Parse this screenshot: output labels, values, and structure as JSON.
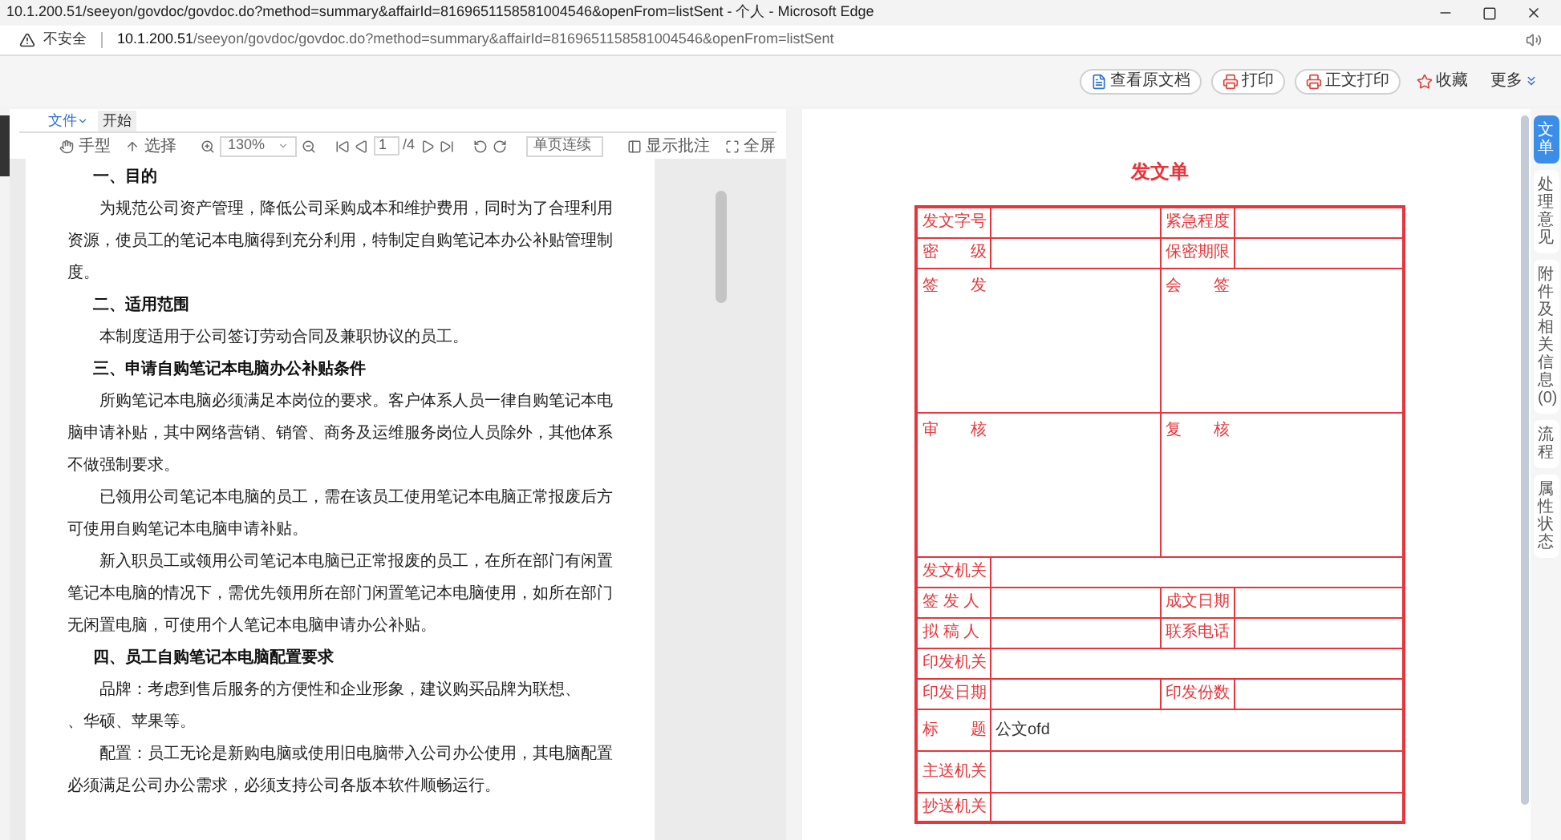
{
  "browser": {
    "title": "10.1.200.51/seeyon/govdoc/govdoc.do?method=summary&affairId=8169651158581004546&openFrom=listSent - 个人 - Microsoft Edge",
    "security_label": "不安全",
    "url_host": "10.1.200.51",
    "url_path": "/seeyon/govdoc/govdoc.do?method=summary&affairId=8169651158581004546&openFrom=listSent"
  },
  "actions": [
    {
      "kind": "doc",
      "label": "查看原文档"
    },
    {
      "kind": "print",
      "label": "打印"
    },
    {
      "kind": "print",
      "label": "正文打印"
    },
    {
      "kind": "star",
      "label": "收藏"
    },
    {
      "kind": "more",
      "label": "更多"
    }
  ],
  "viewer": {
    "file_menu": "文件",
    "tabs": [
      {
        "label": "开始",
        "selected": true
      }
    ],
    "toolbar": [
      {
        "kind": "hand",
        "label": "手型"
      },
      {
        "kind": "select",
        "label": "选择"
      },
      {
        "kind": "separator"
      },
      {
        "kind": "zoomin"
      },
      {
        "kind": "dropdown",
        "label": "130%"
      },
      {
        "kind": "zoomout"
      },
      {
        "kind": "separator"
      },
      {
        "kind": "first"
      },
      {
        "kind": "prev"
      },
      {
        "kind": "page",
        "label": "1",
        "total": "/4"
      },
      {
        "kind": "next"
      },
      {
        "kind": "last"
      },
      {
        "kind": "separator"
      },
      {
        "kind": "rotateleft"
      },
      {
        "kind": "rotateright"
      },
      {
        "kind": "separator"
      },
      {
        "kind": "dropdown",
        "label": "单页连续"
      },
      {
        "kind": "separator"
      },
      {
        "kind": "annotations",
        "label": "显示批注"
      },
      {
        "kind": "fullscreen",
        "label": "全屏"
      }
    ],
    "document": [
      {
        "kind": "heading",
        "text": "一、目的"
      },
      {
        "kind": "paragraph",
        "text": "为规范公司资产管理，降低公司采购成本和维护费用，同时为了合理利用资源，使员工的笔记本电脑得到充分利用，特制定自购笔记本办公补贴管理制度。"
      },
      {
        "kind": "heading",
        "text": "二、适用范围"
      },
      {
        "kind": "paragraph",
        "text": "本制度适用于公司签订劳动合同及兼职协议的员工。"
      },
      {
        "kind": "heading",
        "text": "三、申请自购笔记本电脑办公补贴条件"
      },
      {
        "kind": "paragraph",
        "text": "所购笔记本电脑必须满足本岗位的要求。客户体系人员一律自购笔记本电脑申请补贴，其中网络营销、销管、商务及运维服务岗位人员除外，其他体系不做强制要求。"
      },
      {
        "kind": "paragraph",
        "text": "已领用公司笔记本电脑的员工，需在该员工使用笔记本电脑正常报废后方可使用自购笔记本电脑申请补贴。"
      },
      {
        "kind": "paragraph",
        "text": "新入职员工或领用公司笔记本电脑已正常报废的员工，在所在部门有闲置笔记本电脑的情况下，需优先领用所在部门闲置笔记本电脑使用，如所在部门无闲置电脑，可使用个人笔记本电脑申请办公补贴。"
      },
      {
        "kind": "heading",
        "text": "四、员工自购笔记本电脑配置要求"
      },
      {
        "kind": "paragraph",
        "text": "品牌：考虑到售后服务的方便性和企业形象，建议购买品牌为联想、"
      },
      {
        "kind": "continuation",
        "text": "、华硕、苹果等。"
      },
      {
        "kind": "paragraph",
        "text": "配置：员工无论是新购电脑或使用旧电脑带入公司办公使用，其电脑配置必须满足公司办公需求，必须支持公司各版本软件顺畅运行。"
      }
    ]
  },
  "form": {
    "title": "发文单",
    "rows": [
      {
        "kind": "normal",
        "cells": [
          {
            "kind": "label",
            "text": "发文字号"
          },
          {
            "kind": "value"
          },
          {
            "kind": "label",
            "text": "紧急程度"
          },
          {
            "kind": "value"
          }
        ]
      },
      {
        "kind": "normal",
        "cells": [
          {
            "kind": "label",
            "text": "密　　级"
          },
          {
            "kind": "value"
          },
          {
            "kind": "label",
            "text": "保密期限"
          },
          {
            "kind": "value"
          }
        ]
      },
      {
        "kind": "tall",
        "cells": [
          {
            "kind": "box",
            "text": "签　　发",
            "colspan": 2
          },
          {
            "kind": "box",
            "text": "会　　签",
            "colspan": 2
          }
        ]
      },
      {
        "kind": "tall",
        "cells": [
          {
            "kind": "box",
            "text": "审　　核",
            "colspan": 2
          },
          {
            "kind": "box",
            "text": "复　　核",
            "colspan": 2
          }
        ]
      },
      {
        "kind": "normal",
        "cells": [
          {
            "kind": "label",
            "text": "发文机关"
          },
          {
            "kind": "value",
            "colspan": 3
          }
        ]
      },
      {
        "kind": "normal",
        "cells": [
          {
            "kind": "label",
            "text": "签 发 人"
          },
          {
            "kind": "value"
          },
          {
            "kind": "label",
            "text": "成文日期"
          },
          {
            "kind": "value"
          }
        ]
      },
      {
        "kind": "normal",
        "cells": [
          {
            "kind": "label",
            "text": "拟 稿 人"
          },
          {
            "kind": "value"
          },
          {
            "kind": "label",
            "text": "联系电话"
          },
          {
            "kind": "value"
          }
        ]
      },
      {
        "kind": "normal",
        "cells": [
          {
            "kind": "label",
            "text": "印发机关"
          },
          {
            "kind": "value",
            "colspan": 3
          }
        ]
      },
      {
        "kind": "normal",
        "cells": [
          {
            "kind": "label",
            "text": "印发日期"
          },
          {
            "kind": "value"
          },
          {
            "kind": "label",
            "text": "印发份数"
          },
          {
            "kind": "value"
          }
        ]
      },
      {
        "kind": "medium",
        "cells": [
          {
            "kind": "label",
            "text": "标　　题"
          },
          {
            "kind": "value",
            "text": "公文ofd",
            "colspan": 3
          }
        ]
      },
      {
        "kind": "medium",
        "cells": [
          {
            "kind": "label",
            "text": "主送机关"
          },
          {
            "kind": "value",
            "colspan": 3
          }
        ]
      },
      {
        "kind": "normal",
        "cells": [
          {
            "kind": "label",
            "text": "抄送机关"
          },
          {
            "kind": "value",
            "colspan": 3
          }
        ]
      }
    ]
  },
  "side_tabs": [
    {
      "label": "文单",
      "selected": true
    },
    {
      "label": "处理意见",
      "selected": false
    },
    {
      "label": "附件及相关信息(0)",
      "selected": false
    },
    {
      "label": "流程",
      "selected": false
    },
    {
      "label": "属性状态",
      "selected": false
    }
  ]
}
